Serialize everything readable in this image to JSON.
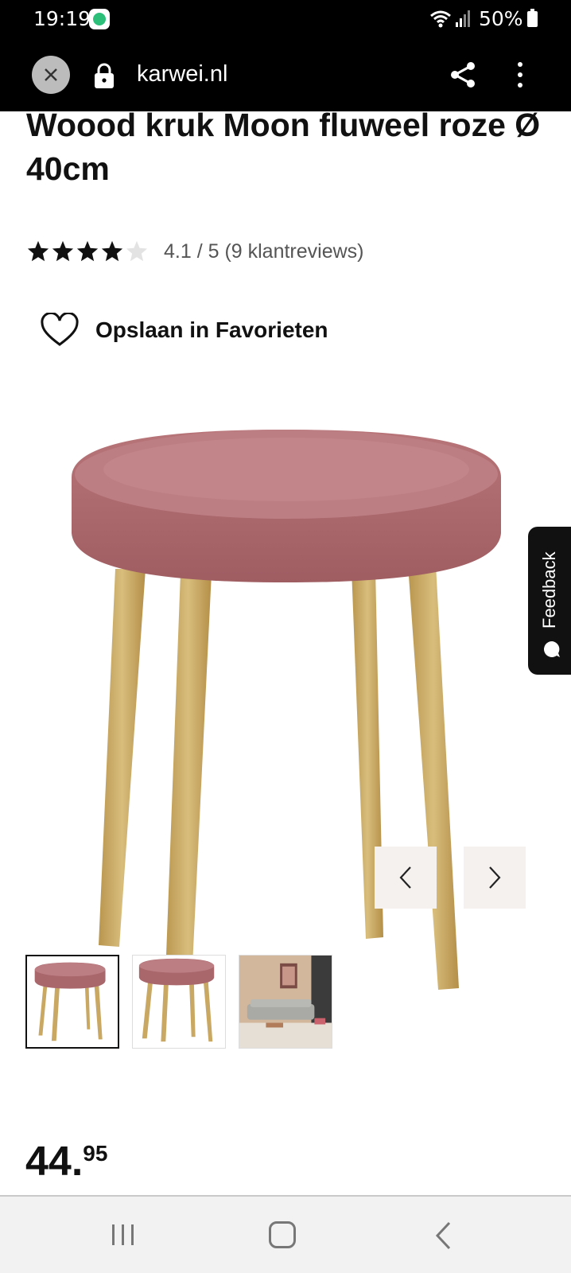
{
  "status_bar": {
    "time": "19:19",
    "battery": "50%"
  },
  "browser": {
    "url": "karwei.nl"
  },
  "product": {
    "title": "Woood kruk Moon fluweel roze Ø 40cm",
    "rating": {
      "score": 4.1,
      "stars_filled": 4,
      "stars_total": 5,
      "text": "4.1 / 5 (9 klantreviews)"
    },
    "favorite_label": "Opslaan in Favorieten",
    "price_whole": "44.",
    "price_cents": "95"
  },
  "feedback_tab": {
    "label": "Feedback"
  },
  "colors": {
    "velvet": "#b67378",
    "wood": "#c9a863",
    "accent_dark": "#111111"
  }
}
